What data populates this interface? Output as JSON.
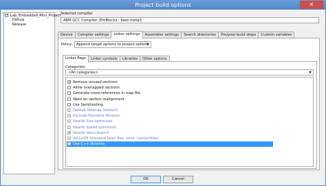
{
  "window": {
    "title": "Project build options",
    "close_label": "✕"
  },
  "tree": {
    "root": "Lab_Embedded_Mini_Project",
    "toggle": "−",
    "children": [
      "Debug",
      "Release"
    ]
  },
  "compiler": {
    "label": "Selected compiler",
    "value": "ARM GCC Compiler (EmBlocks - bare-metal)"
  },
  "tabs": [
    "Device",
    "Compiler settings",
    "Linker settings",
    "Assembler settings",
    "Search directories",
    "Pre/post build steps",
    "Custom variables"
  ],
  "policy": {
    "label": "Policy:",
    "value": "Append target options to project options",
    "arrow": "▼"
  },
  "subtabs": [
    "Linker flags",
    "Linker symbols",
    "Libraries",
    "Other options"
  ],
  "categories": {
    "label": "Categories:",
    "value": "<All categories>",
    "arrow": "▼"
  },
  "flags": [
    {
      "label": "Remove unused sections",
      "checked": true,
      "enabled": true
    },
    {
      "label": "Allow overlapped sections",
      "checked": false,
      "enabled": true
    },
    {
      "label": "Generate cross-references in map file",
      "checked": false,
      "enabled": true
    },
    {
      "label": "Warn on section realignment",
      "checked": false,
      "enabled": true
    },
    {
      "label": "Use Semihosting",
      "checked": false,
      "enabled": true
    },
    {
      "label": "Default libraries (default)",
      "checked": false,
      "enabled": false
    },
    {
      "label": "Exclude Standard libraries",
      "checked": false,
      "enabled": false
    },
    {
      "label": "Newlib Size optimized",
      "checked": false,
      "enabled": false
    },
    {
      "label": "Newlib Speed optimized",
      "checked": false,
      "enabled": false
    },
    {
      "label": "Newlib Nano-branch",
      "checked": true,
      "enabled": false
    },
    {
      "label": "INCLUDE Standard Start files (omit -nostartfiles)",
      "checked": false,
      "enabled": false
    },
    {
      "label": "Use C++ libraries",
      "checked": true,
      "enabled": false,
      "selected": true
    }
  ],
  "buttons": {
    "ok": "OK",
    "cancel": "Cancel"
  }
}
